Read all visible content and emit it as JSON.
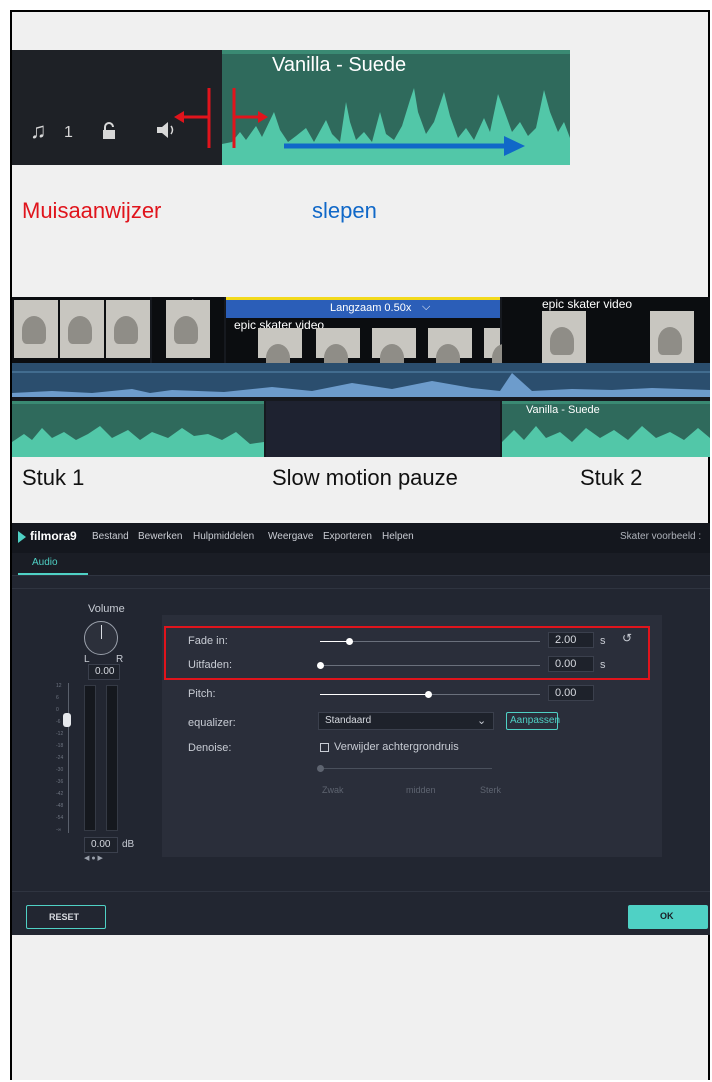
{
  "shot1": {
    "track_number": "1",
    "clip_title": "Vanilla - Suede"
  },
  "captions1": {
    "pointer": "Muisaanwijzer",
    "drag": "slepen"
  },
  "shot2": {
    "clip1_name": "epic skate",
    "speed_label": "Langzaam 0.50x",
    "clip_mid_name": "epic skater video",
    "clip2_name": "epic skater video",
    "audio_name": "Vanilla - Suede"
  },
  "captions2": {
    "part1": "Stuk 1",
    "pause": "Slow motion pauze",
    "part2": "Stuk 2"
  },
  "filmora": {
    "logo": "filmora9",
    "menu": [
      "Bestand",
      "Bewerken",
      "Hulpmiddelen",
      "Weergave",
      "Exporteren",
      "Helpen"
    ],
    "project_title": "Skater voorbeeld :",
    "tab": "Audio",
    "volume_label": "Volume",
    "left_label": "L",
    "right_label": "R",
    "volume_value": "0.00",
    "db_value": "0.00",
    "db_unit": "dB",
    "scale": [
      "12",
      "6",
      "0",
      "-6",
      "-12",
      "-18",
      "-24",
      "-30",
      "-36",
      "-42",
      "-48",
      "-54",
      "-∞"
    ],
    "fade_in_label": "Fade in:",
    "fade_in_value": "2.00",
    "fade_in_level": 0.13,
    "fade_out_label": "Uitfaden:",
    "fade_out_value": "0.00",
    "fade_out_level": 0.0,
    "unit_s": "s",
    "pitch_label": "Pitch:",
    "pitch_value": "0.00",
    "pitch_level": 0.5,
    "equalizer_label": "equalizer:",
    "equalizer_value": "Standaard",
    "adjust_button": "Aanpassen",
    "denoise_label": "Denoise:",
    "denoise_checkbox": "Verwijder achtergrondruis",
    "denoise_checked": false,
    "denoise_levels": [
      "Zwak",
      "midden",
      "Sterk"
    ],
    "reset_button": "RESET",
    "ok_button": "OK",
    "colors": {
      "accent": "#4fd1c5",
      "highlight_box": "#e0141c"
    }
  }
}
